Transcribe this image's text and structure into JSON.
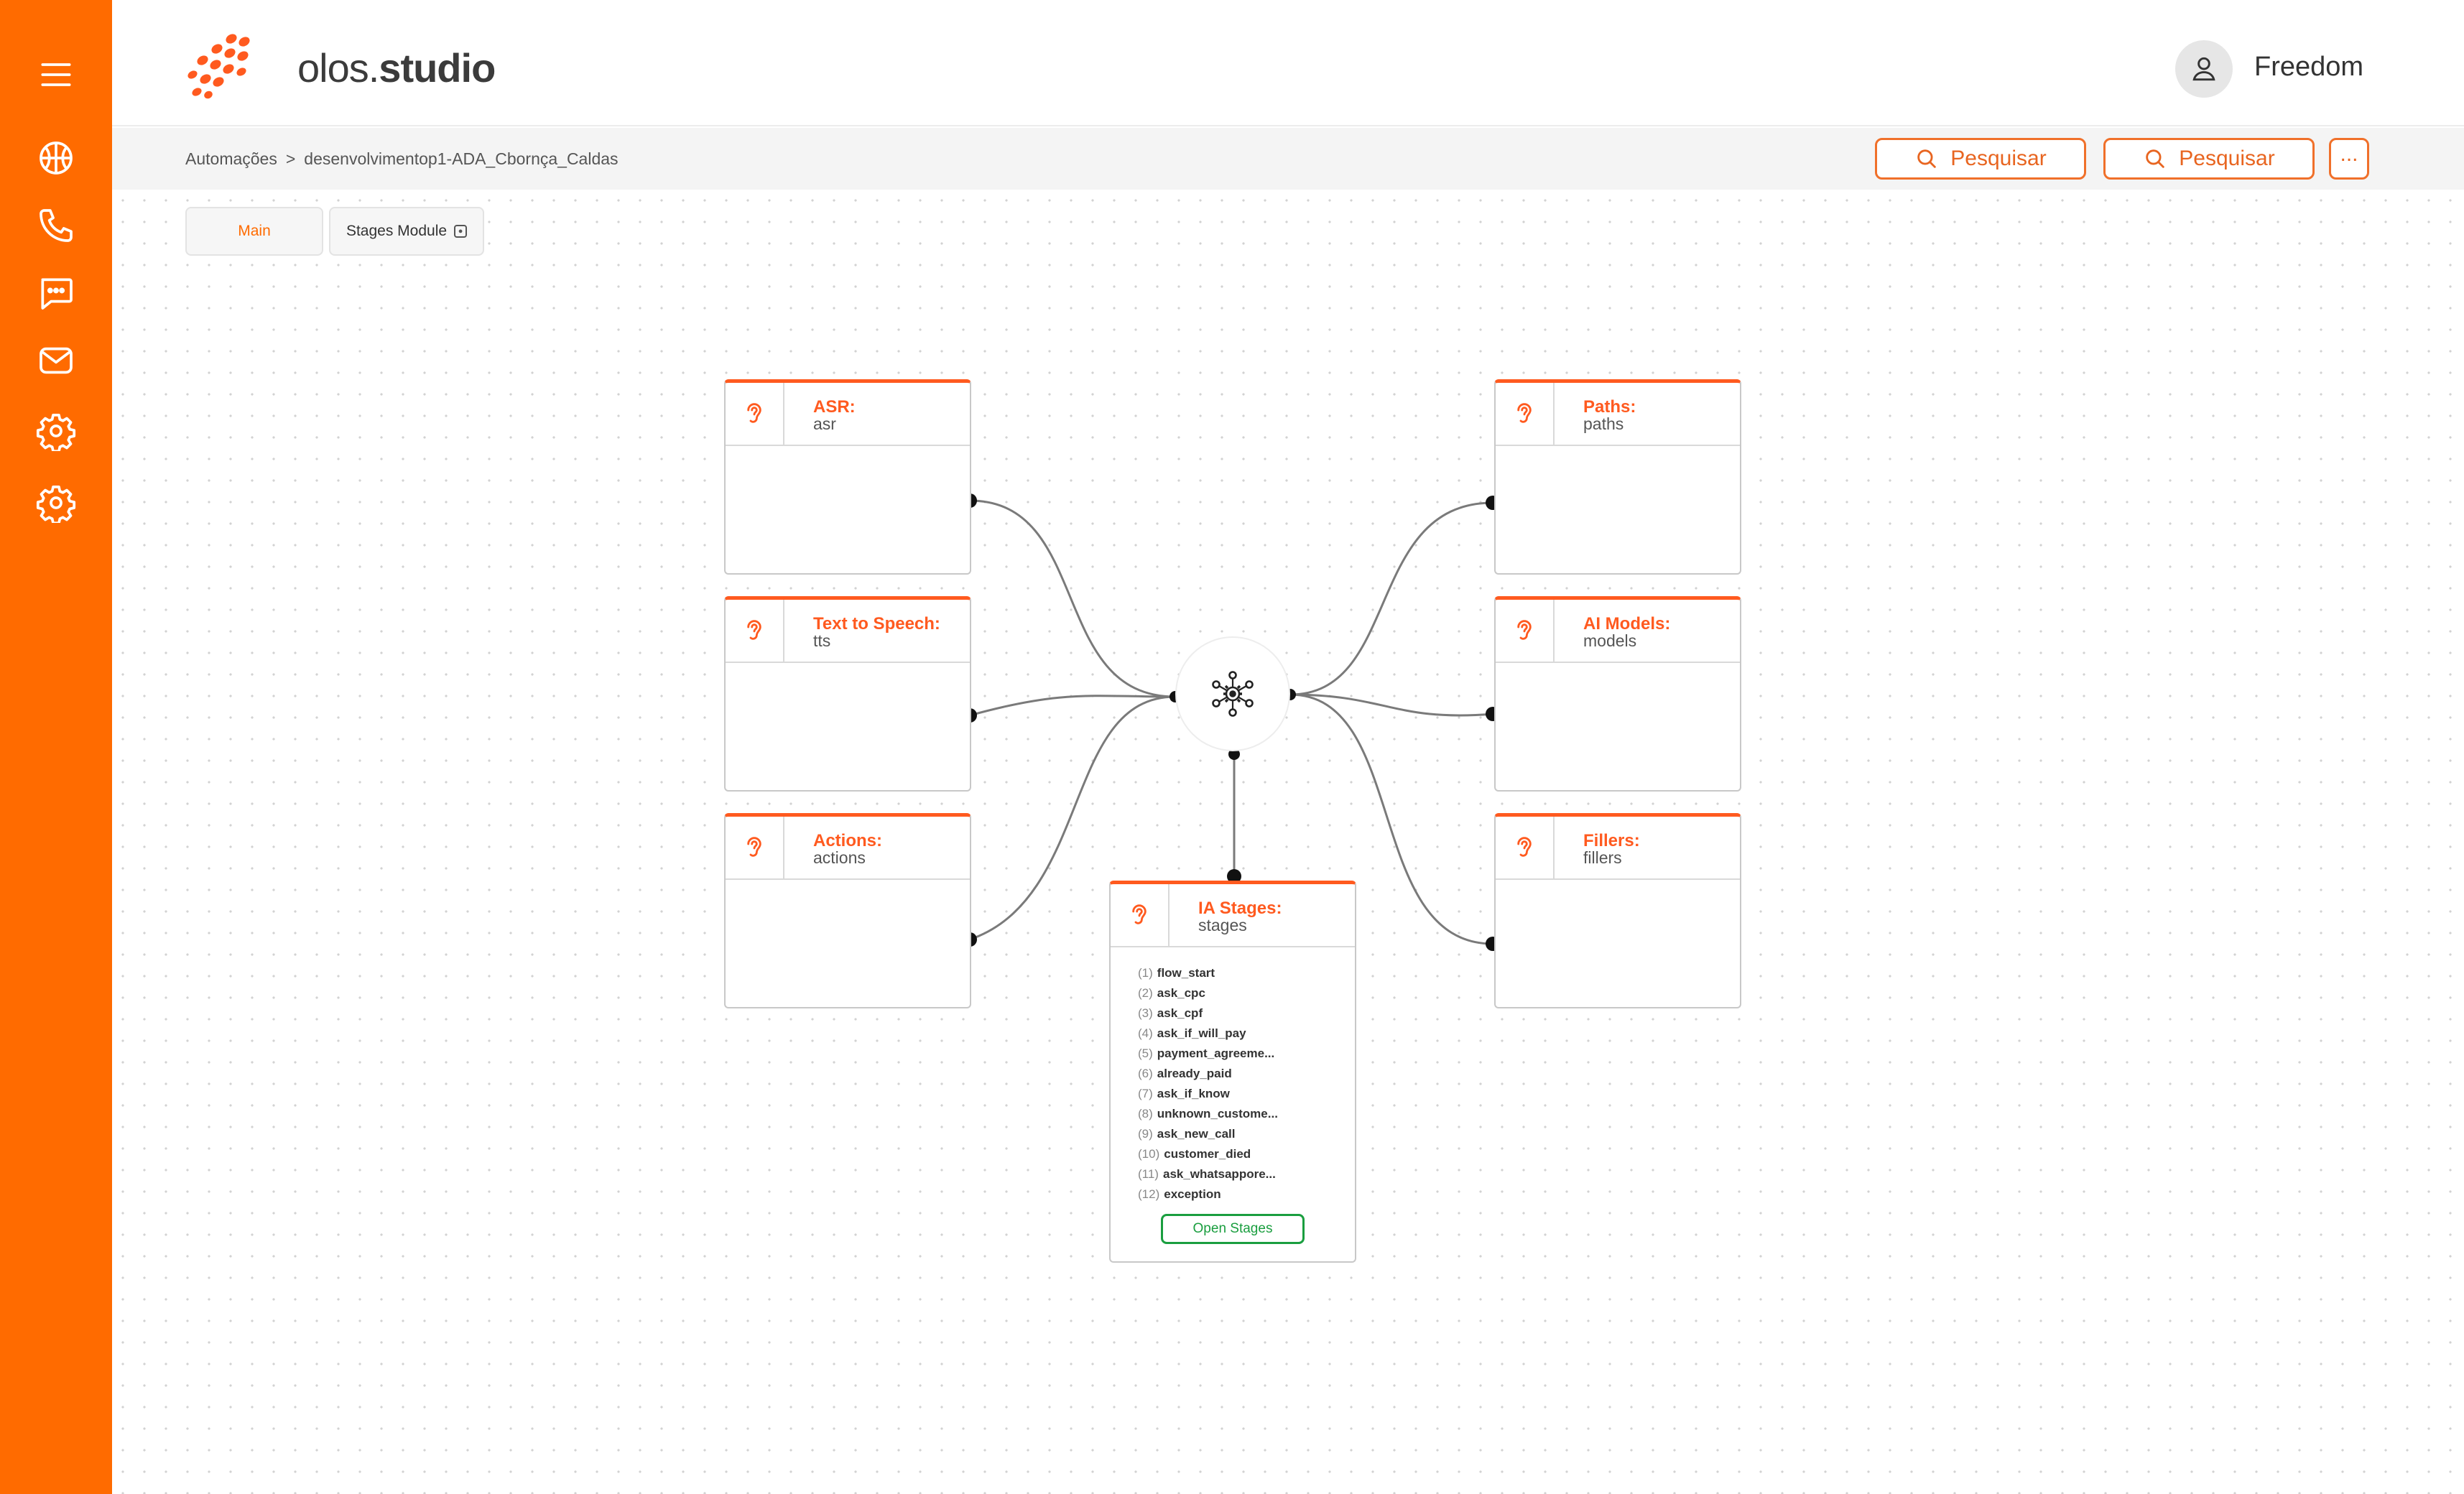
{
  "brand": {
    "name_light": "olos.",
    "name_bold": "studio"
  },
  "user": {
    "name": "Freedom"
  },
  "breadcrumb": {
    "root": "Automações",
    "separator": ">",
    "current": "desenvolvimentop1-ADA_Cbornça_Caldas"
  },
  "toolbar": {
    "search1_label": "Pesquisar",
    "search2_label": "Pesquisar",
    "more_label": "..."
  },
  "tabs": {
    "main": "Main",
    "stages": "Stages Module"
  },
  "sidebar": {
    "items": [
      {
        "icon": "menu-icon"
      },
      {
        "icon": "basketball-icon"
      },
      {
        "icon": "phone-icon"
      },
      {
        "icon": "chat-icon"
      },
      {
        "icon": "mail-icon"
      },
      {
        "icon": "gear-icon"
      },
      {
        "icon": "gear-icon"
      }
    ]
  },
  "nodes": {
    "asr": {
      "title": "ASR:",
      "sub": "asr"
    },
    "tts": {
      "title": "Text to Speech:",
      "sub": "tts"
    },
    "actions": {
      "title": "Actions:",
      "sub": "actions"
    },
    "paths": {
      "title": "Paths:",
      "sub": "paths"
    },
    "models": {
      "title": "AI Models:",
      "sub": "models"
    },
    "fillers": {
      "title": "Fillers:",
      "sub": "fillers"
    },
    "stages": {
      "title": "IA Stages:",
      "sub": "stages",
      "open_label": "Open Stages",
      "items": [
        {
          "idx": "(1)",
          "name": "flow_start"
        },
        {
          "idx": "(2)",
          "name": "ask_cpc"
        },
        {
          "idx": "(3)",
          "name": "ask_cpf"
        },
        {
          "idx": "(4)",
          "name": "ask_if_will_pay"
        },
        {
          "idx": "(5)",
          "name": "payment_agreeme..."
        },
        {
          "idx": "(6)",
          "name": "already_paid"
        },
        {
          "idx": "(7)",
          "name": "ask_if_know"
        },
        {
          "idx": "(8)",
          "name": "unknown_custome..."
        },
        {
          "idx": "(9)",
          "name": "ask_new_call"
        },
        {
          "idx": "(10)",
          "name": "customer_died"
        },
        {
          "idx": "(11)",
          "name": "ask_whatsappore..."
        },
        {
          "idx": "(12)",
          "name": "exception"
        }
      ]
    }
  },
  "colors": {
    "accent": "#ff6b00",
    "node_border": "#ff5a1f",
    "success": "#1a9e3f"
  }
}
